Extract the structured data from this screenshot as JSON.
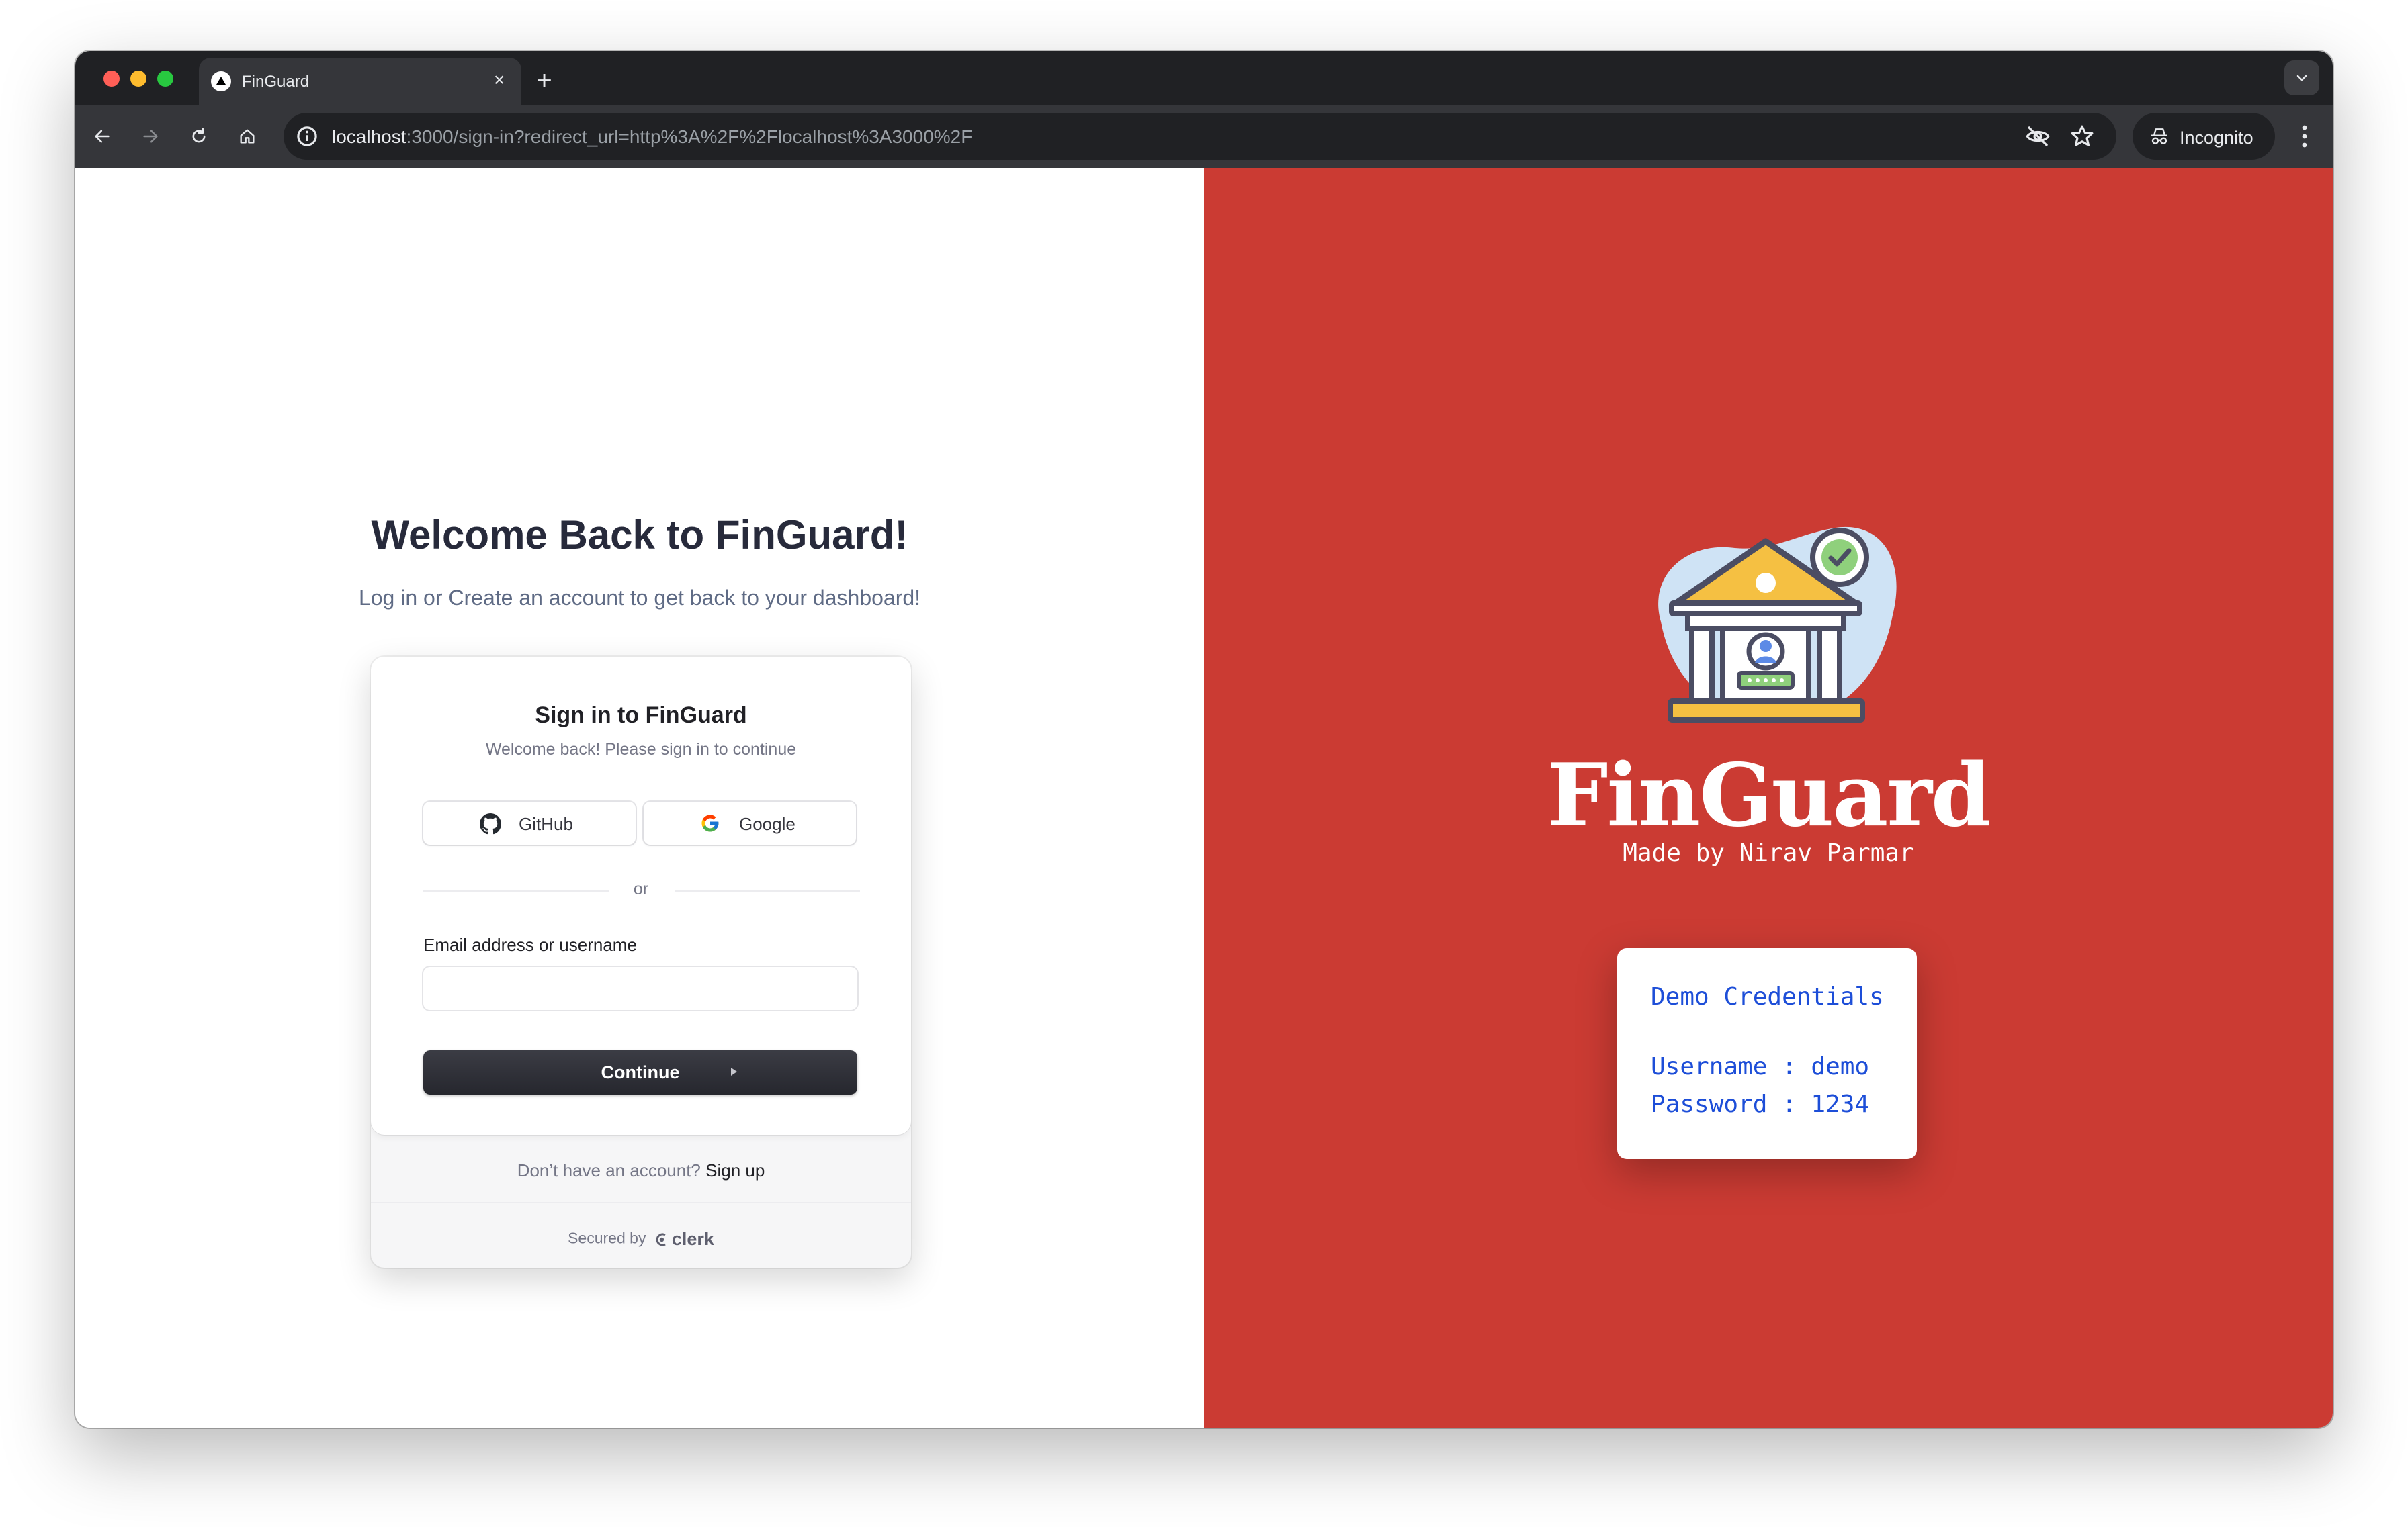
{
  "browser": {
    "tab_title": "FinGuard",
    "url_host": "localhost",
    "url_rest": ":3000/sign-in?redirect_url=http%3A%2F%2Flocalhost%3A3000%2F",
    "incognito_label": "Incognito"
  },
  "left": {
    "heading": "Welcome Back to FinGuard!",
    "subheading": "Log in or Create an account to get back to your dashboard!"
  },
  "signin": {
    "title": "Sign in to FinGuard",
    "subtitle": "Welcome back! Please sign in to continue",
    "github_label": "GitHub",
    "google_label": "Google",
    "divider_text": "or",
    "email_label": "Email address or username",
    "email_value": "",
    "continue_label": "Continue",
    "no_account_text": "Don’t have an account?",
    "signup_link": "Sign up",
    "secured_by": "Secured by",
    "clerk_brand": "clerk"
  },
  "right": {
    "brand": "FinGuard",
    "made_by": "Made by Nirav Parmar",
    "credentials": {
      "title": "Demo Credentials",
      "username_line": "Username : demo",
      "password_line": "Password : 1234"
    }
  },
  "colors": {
    "accent_red": "#cb3b33",
    "credential_blue": "#1d4ed8",
    "heading_dark": "#272a3b",
    "button_dark": "#2f3037"
  },
  "icons": [
    "back-arrow-icon",
    "forward-arrow-icon",
    "reload-icon",
    "home-icon",
    "site-info-icon",
    "eye-off-icon",
    "star-icon",
    "incognito-icon",
    "kebab-menu-icon",
    "github-icon",
    "google-icon",
    "clerk-logo-icon",
    "bank-icon"
  ]
}
